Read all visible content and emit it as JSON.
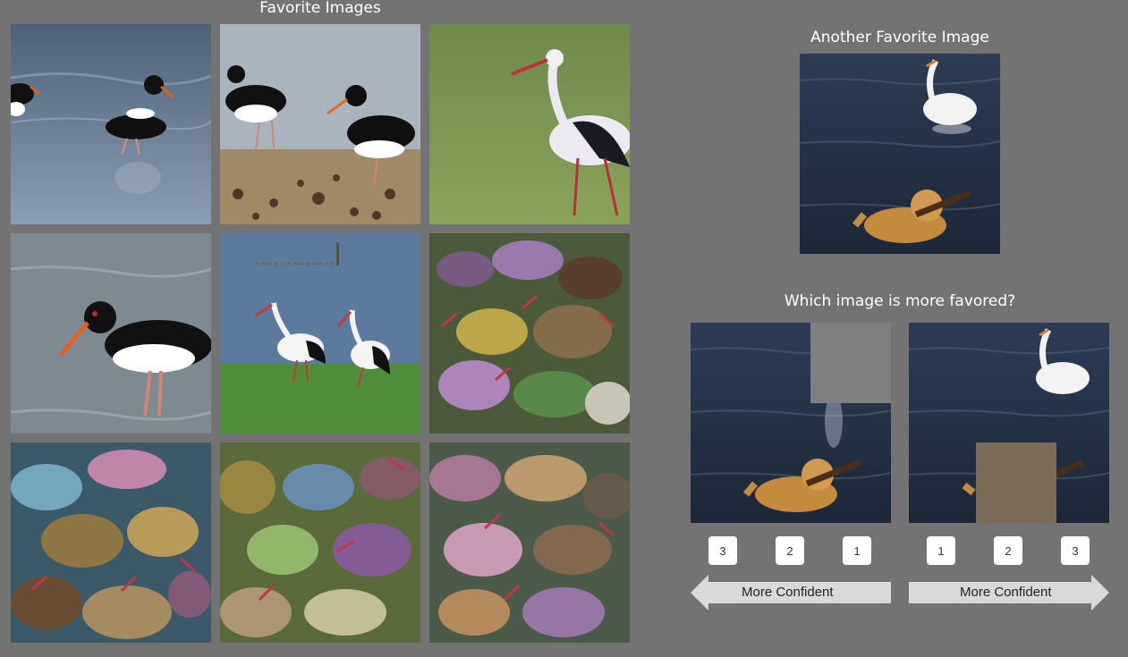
{
  "left_panel": {
    "title": "Favorite Images",
    "tiles": [
      {
        "subject": "oystercatchers on shoreline"
      },
      {
        "subject": "oystercatchers on pebble beach"
      },
      {
        "subject": "white stork on grass"
      },
      {
        "subject": "oystercatcher in water"
      },
      {
        "subject": "two white storks at lake"
      },
      {
        "subject": "generated bird pattern"
      },
      {
        "subject": "generated bird pattern"
      },
      {
        "subject": "generated bird pattern"
      },
      {
        "subject": "generated bird pattern"
      }
    ]
  },
  "right_panel": {
    "another_title": "Another Favorite Image",
    "question": "Which image is more favored?",
    "left_choice": {
      "occluder_color": "#7d7f80",
      "ranks": [
        "3",
        "2",
        "1"
      ],
      "arrow_label": "More Confident",
      "arrow_direction": "left"
    },
    "right_choice": {
      "occluder_color": "#7b6a55",
      "ranks": [
        "1",
        "2",
        "3"
      ],
      "arrow_label": "More Confident",
      "arrow_direction": "right"
    }
  },
  "colors": {
    "background": "#737373",
    "button_bg": "#ffffff",
    "arrow_fill": "#d9d9d9"
  }
}
